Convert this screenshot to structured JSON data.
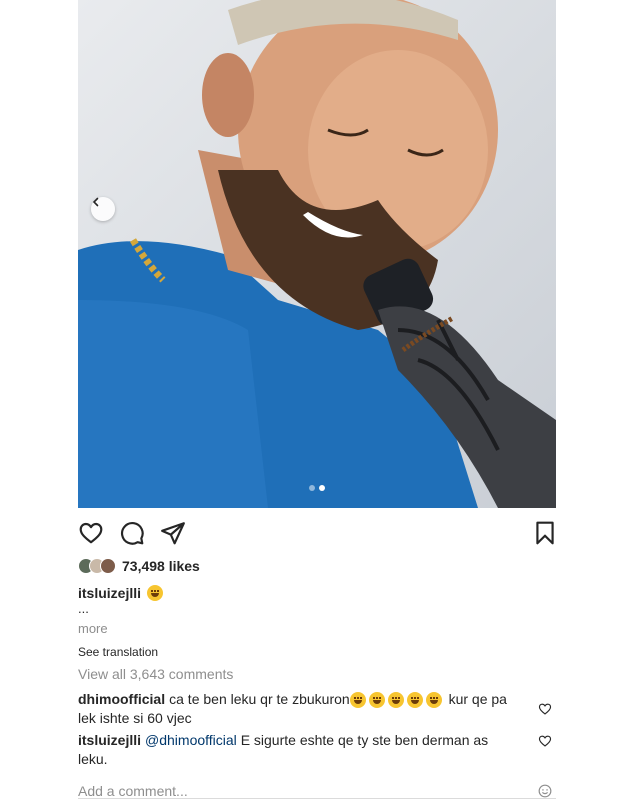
{
  "post": {
    "image_alt": "Smiling bearded man in blue sweatshirt with tattooed arm",
    "carousel": {
      "total": 2,
      "current": 2
    },
    "likes_text": "73,498 likes",
    "caption": {
      "username": "itsluizejlli",
      "ellipsis": "...",
      "more": "more"
    },
    "see_translation": "See translation",
    "view_all": "View all 3,643 comments",
    "comments": [
      {
        "username": "dhimoofficial",
        "text": "ca te ben leku qr te zbukuron",
        "emoji_count": 5,
        "text2": "kur qe pa lek ishte si 60 vjec"
      },
      {
        "username": "itsluizejlli",
        "mention": "@dhimoofficial",
        "text": "E sigurte eshte qe ty ste ben derman as leku."
      }
    ],
    "add_comment_placeholder": "Add a comment..."
  },
  "icons": [
    "chevron-left-icon",
    "heart-icon",
    "comment-icon",
    "share-icon",
    "bookmark-icon",
    "emoji-icon"
  ],
  "colors": {
    "link": "#00376b",
    "muted": "#8e8e8e",
    "text": "#262626",
    "shirt": "#1f6fb8"
  }
}
